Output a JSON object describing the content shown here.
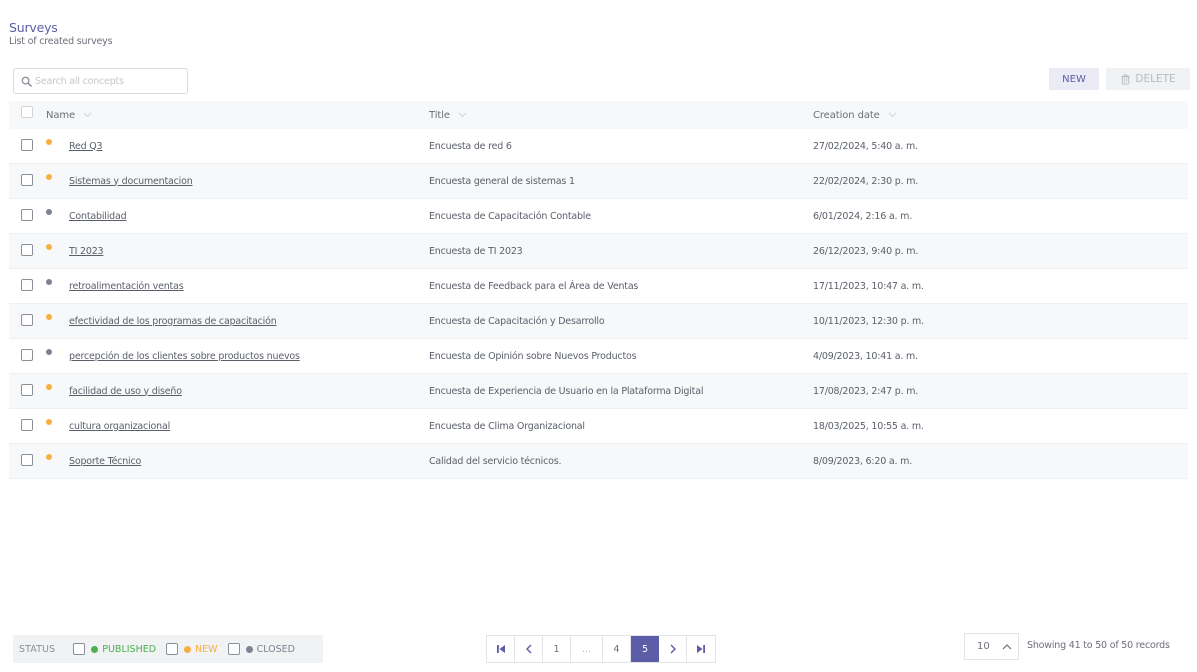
{
  "header": {
    "title": "Surveys",
    "subtitle": "List of created surveys"
  },
  "search": {
    "placeholder": "Search all concepts"
  },
  "toolbar": {
    "new_label": "NEW",
    "delete_label": "DELETE"
  },
  "table": {
    "columns": {
      "name": "Name",
      "title": "Title",
      "date": "Creation date"
    },
    "rows": [
      {
        "status": "new",
        "name": "Red Q3",
        "title": "Encuesta de red 6",
        "date": "27/02/2024, 5:40 a. m."
      },
      {
        "status": "new",
        "name": "Sistemas y documentacion",
        "title": "Encuesta general de sistemas 1",
        "date": "22/02/2024, 2:30 p. m."
      },
      {
        "status": "closed",
        "name": "Contabilidad",
        "title": "Encuesta de Capacitación Contable",
        "date": "6/01/2024, 2:16 a. m."
      },
      {
        "status": "new",
        "name": "TI 2023",
        "title": "Encuesta de TI 2023",
        "date": "26/12/2023, 9:40 p. m."
      },
      {
        "status": "closed",
        "name": "retroalimentación ventas",
        "title": "Encuesta de Feedback para el Área de Ventas",
        "date": "17/11/2023, 10:47 a. m."
      },
      {
        "status": "new",
        "name": "efectividad de los programas de capacitación",
        "title": "Encuesta de Capacitación y Desarrollo",
        "date": "10/11/2023, 12:30 p. m."
      },
      {
        "status": "closed",
        "name": "percepción de los clientes sobre productos nuevos",
        "title": "Encuesta de Opinión sobre Nuevos Productos",
        "date": "4/09/2023, 10:41 a. m."
      },
      {
        "status": "new",
        "name": "facilidad de uso y diseño",
        "title": "Encuesta de Experiencia de Usuario en la Plataforma Digital",
        "date": "17/08/2023, 2:47 p. m."
      },
      {
        "status": "new",
        "name": "cultura organizacional",
        "title": "Encuesta de Clima Organizacional",
        "date": "18/03/2025, 10:55 a. m."
      },
      {
        "status": "new",
        "name": "Soporte Técnico",
        "title": "Calidad del servicio técnicos.",
        "date": "8/09/2023, 6:20 a. m."
      }
    ]
  },
  "status_filter": {
    "label": "STATUS",
    "items": [
      {
        "key": "published",
        "label": "PUBLISHED",
        "color": "#4caf50"
      },
      {
        "key": "new",
        "label": "NEW",
        "color": "#f5b041"
      },
      {
        "key": "closed",
        "label": "CLOSED",
        "color": "#7d8290"
      }
    ]
  },
  "status_colors": {
    "new": "#f5b041",
    "closed": "#7d8290",
    "published": "#4caf50"
  },
  "pagination": {
    "pages": [
      "1",
      "...",
      "4",
      "5"
    ],
    "current": "5"
  },
  "page_size": {
    "value": "10"
  },
  "records": {
    "text": "Showing 41 to 50 of 50 records"
  },
  "colors": {
    "accent": "#5b5ea6"
  }
}
